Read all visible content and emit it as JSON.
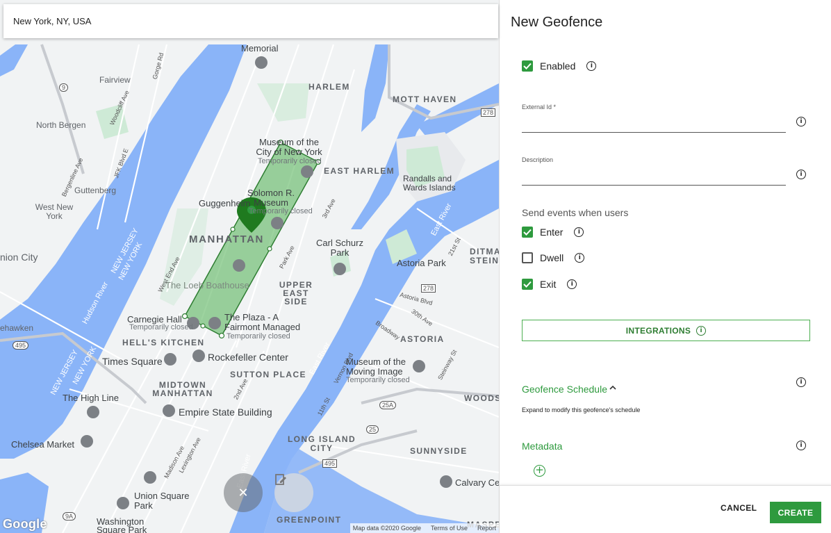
{
  "search": {
    "value": "New York, NY, USA"
  },
  "map": {
    "neighborhoods": [
      "HARLEM",
      "MOTT HAVEN",
      "EAST HARLEM",
      "MANHATTAN",
      "UPPER EAST SIDE",
      "HELL'S KITCHEN",
      "MIDTOWN MANHATTAN",
      "SUTTON PLACE",
      "ASTORIA",
      "LONG ISLAND CITY",
      "SUNNYSIDE",
      "GREENPOINT",
      "DITMARS STEINW",
      "WOODS",
      "MASPE"
    ],
    "places": [
      "Fairview",
      "North Bergen",
      "Guttenberg",
      "West New York",
      "nion City",
      "ehawken",
      "Randalls and Wards Islands",
      "Astoria Park",
      "Carl Schurz Park",
      "Chelsea Market",
      "The High Line",
      "Union Square Park",
      "Washington Square Park",
      "Times Square",
      "Rockefeller Center",
      "Empire State Building",
      "The Loeb Boathouse",
      "Guggenheim",
      "Museum of the City of New York",
      "Temporarily closed",
      "Solomon R. Museum",
      "Carnegie Hall",
      "The Plaza - A Fairmont Managed",
      "Museum of the Moving Image",
      "Calvary Ce",
      "Memorial"
    ],
    "water": [
      "Hudson River",
      "East River",
      "NEW JERSEY",
      "NEW YORK"
    ],
    "streets": [
      "Gorge Rd",
      "Woodcliff Ave",
      "Bergenline Ave",
      "JFK Blvd E",
      "Park Ave",
      "2nd Ave",
      "3rd Ave",
      "Lexington Ave",
      "West End Ave",
      "Madison Ave",
      "11th St",
      "21st St",
      "Vernon Blvd",
      "Broadway",
      "30th Ave",
      "Steinway St",
      "Astoria Blvd"
    ],
    "routes": [
      "9",
      "278",
      "495",
      "25A",
      "25",
      "9A"
    ],
    "attribution": {
      "data": "Map data ©2020 Google",
      "terms": "Terms of Use",
      "report": "Report"
    },
    "google_logo": "Google",
    "geofence_color": "#4caf50",
    "marker_color": "#1f7a1f"
  },
  "panel": {
    "title": "New Geofence",
    "enabled_label": "Enabled",
    "enabled": true,
    "external_id_label": "External Id *",
    "external_id_value": "",
    "description_label": "Description",
    "description_value": "",
    "events_heading": "Send events when users",
    "events": [
      {
        "label": "Enter",
        "checked": true
      },
      {
        "label": "Dwell",
        "checked": false
      },
      {
        "label": "Exit",
        "checked": true
      }
    ],
    "integrations_label": "INTEGRATIONS",
    "schedule_heading": "Geofence Schedule",
    "schedule_hint": "Expand to modify this geofence's schedule",
    "metadata_heading": "Metadata",
    "cancel_label": "CANCEL",
    "create_label": "CREATE",
    "accent_color": "#2e9a3e"
  }
}
